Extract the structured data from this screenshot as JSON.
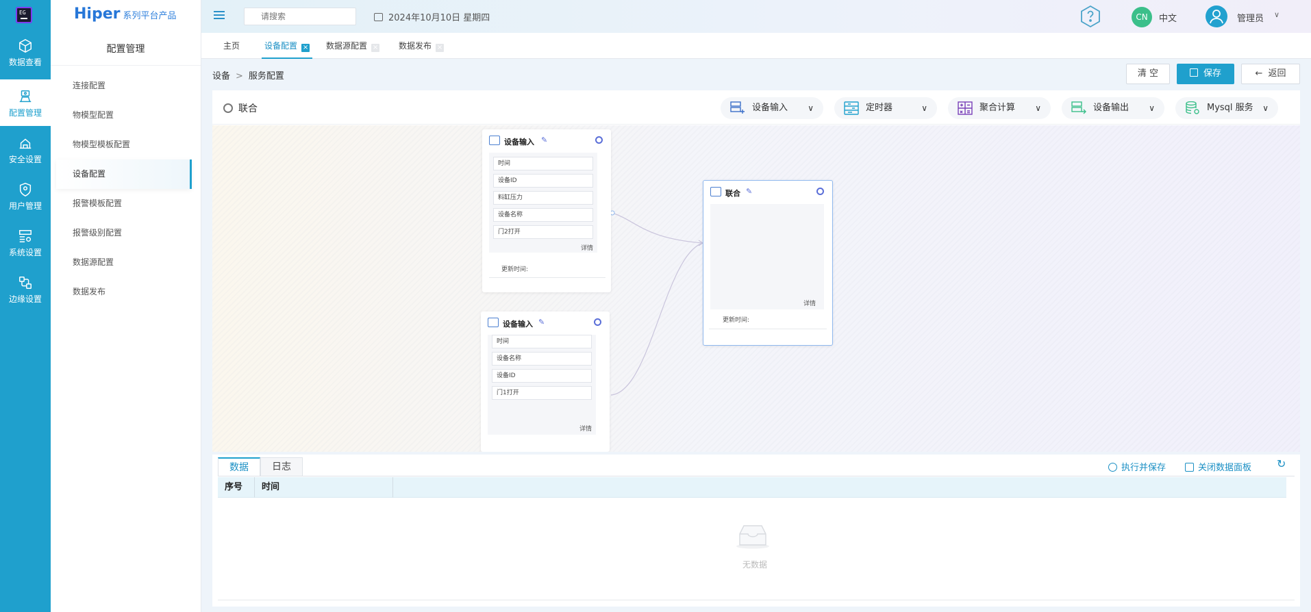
{
  "rail": {
    "items": [
      {
        "label": "数据查看",
        "icon": "cube-icon"
      },
      {
        "label": "配置管理",
        "icon": "config-icon",
        "active": true
      },
      {
        "label": "安全设置",
        "icon": "security-icon"
      },
      {
        "label": "用户管理",
        "icon": "user-shield-icon"
      },
      {
        "label": "系统设置",
        "icon": "system-settings-icon"
      },
      {
        "label": "边缘设置",
        "icon": "edge-icon"
      }
    ]
  },
  "sidebar": {
    "brand": "Hiper",
    "brand_sub": "系列平台产品",
    "title": "配置管理",
    "items": [
      {
        "label": "连接配置"
      },
      {
        "label": "物模型配置"
      },
      {
        "label": "物模型模板配置"
      },
      {
        "label": "设备配置",
        "active": true
      },
      {
        "label": "报警模板配置"
      },
      {
        "label": "报警级别配置"
      },
      {
        "label": "数据源配置"
      },
      {
        "label": "数据发布"
      }
    ]
  },
  "topbar": {
    "search_placeholder": "请搜索",
    "date": "2024年10月10日 星期四",
    "lang_badge": "CN",
    "lang": "中文",
    "user": "管理员"
  },
  "tabs": [
    {
      "label": "主页"
    },
    {
      "label": "设备配置",
      "active": true
    },
    {
      "label": "数据源配置"
    },
    {
      "label": "数据发布"
    }
  ],
  "breadcrumb": {
    "root": "设备",
    "sep": ">",
    "current": "服务配置"
  },
  "actions": {
    "clear": "清 空",
    "save": "保存",
    "back": "返回"
  },
  "panel": {
    "title": "联合",
    "tools": [
      {
        "label": "设备输入"
      },
      {
        "label": "定时器"
      },
      {
        "label": "聚合计算"
      },
      {
        "label": "设备输出"
      },
      {
        "label": "Mysql 服务"
      }
    ]
  },
  "nodes": {
    "input1": {
      "title": "设备输入",
      "fields": [
        "时间",
        "设备ID",
        "料缸压力",
        "设备名称",
        "门2打开"
      ],
      "detail": "详情",
      "updated": "更新时间:"
    },
    "input2": {
      "title": "设备输入",
      "fields": [
        "时间",
        "设备名称",
        "设备ID",
        "门1打开"
      ],
      "detail": "详情"
    },
    "union": {
      "title": "联合",
      "detail": "详情",
      "updated": "更新时间:"
    }
  },
  "data_panel": {
    "tabs": [
      "数据",
      "日志"
    ],
    "run_save": "执行并保存",
    "close_panel": "关闭数据面板",
    "columns": [
      "序号",
      "时间"
    ],
    "empty": "无数据"
  },
  "colors": {
    "primary": "#1fa0cd",
    "accent": "#5a6ed8"
  }
}
